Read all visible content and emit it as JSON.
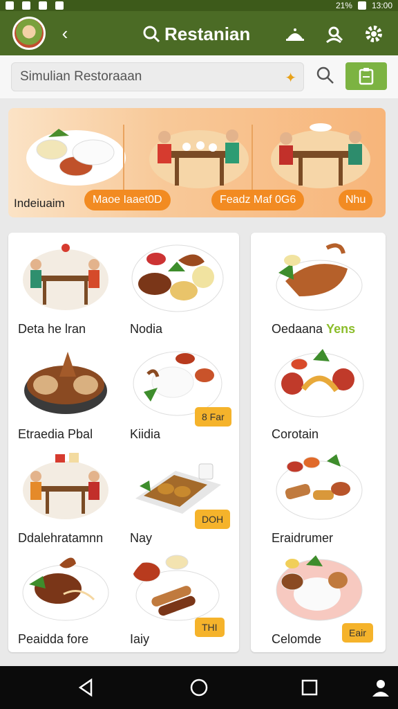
{
  "status_bar": {
    "battery": "21%",
    "time": "13:00"
  },
  "app_bar": {
    "title": "Restanian",
    "icons": [
      "back-icon",
      "search-icon",
      "cloche-icon",
      "person-search-icon",
      "gear-icon"
    ]
  },
  "search": {
    "value": "Simulian Restoraaan",
    "placeholder": "Simulian Restoraaan"
  },
  "banner": {
    "labels": [
      "Indeiuaim",
      "Maoe Iaaet0D",
      "Feadz Maf 0G6",
      "Nhu"
    ]
  },
  "items_left": [
    {
      "label": "Deta he lran",
      "tag": ""
    },
    {
      "label": "Nodia",
      "tag": ""
    },
    {
      "label": "Etraedia Pbal",
      "tag": ""
    },
    {
      "label": "Kiidia",
      "tag": "8 Far"
    },
    {
      "label": "Ddalehratamnn",
      "tag": ""
    },
    {
      "label": "Nay",
      "tag": "DOH"
    },
    {
      "label": "Peaidda fore",
      "tag": ""
    },
    {
      "label": "Iaiy",
      "tag": "THI"
    }
  ],
  "items_right": [
    {
      "label": "Oedaana",
      "label_accent": "Yens",
      "tag": ""
    },
    {
      "label": "Corotain",
      "tag": ""
    },
    {
      "label": "Eraidrumer",
      "tag": ""
    },
    {
      "label": "Celomde",
      "tag": "Eair"
    }
  ],
  "colors": {
    "app_bar": "#4b6b25",
    "accent_green": "#7cb342",
    "orange": "#f28b22",
    "tag": "#f5b32b"
  }
}
